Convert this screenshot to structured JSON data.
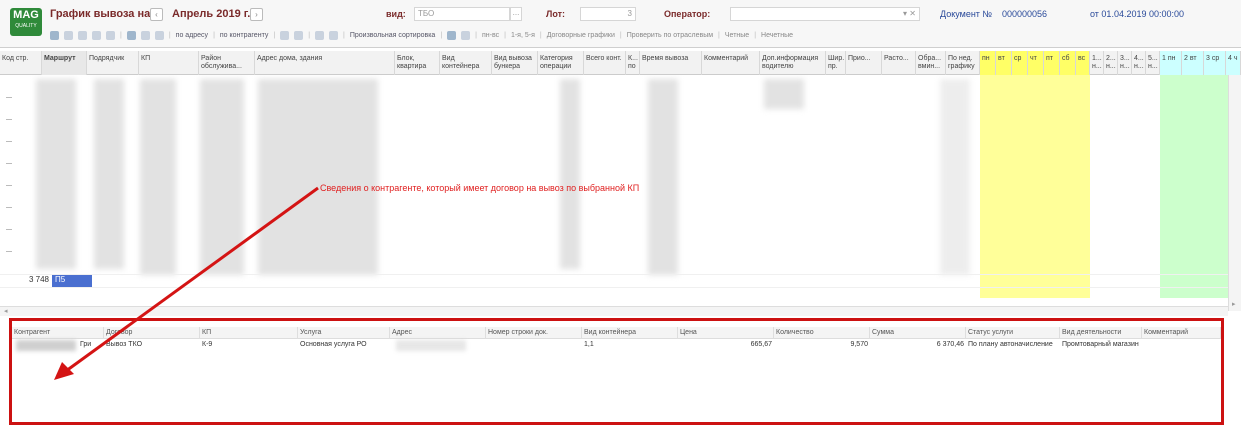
{
  "header": {
    "logo_text": "MAG",
    "logo_sub": "QUALITY",
    "title": "График вывоза на",
    "period": "Апрель 2019 г.",
    "prev_icon": "chevron-left-icon",
    "next_icon": "chevron-right-icon",
    "vid_label": "вид:",
    "vid_value": "ТБО",
    "vid_btn": "...",
    "lot_label": "Лот:",
    "lot_value": "3",
    "operator_label": "Оператор:",
    "operator_btns": "▾ ✕",
    "doc_label": "Документ №",
    "doc_number": "000000056",
    "doc_date": "от  01.04.2019 00:00:00"
  },
  "toolbar": {
    "by_address": "по адресу",
    "by_counterparty": "по контрагенту",
    "custom_sort": "Произвольная сортировка",
    "mon_sun": "пн-вс",
    "fifth_week": "1-я, 5-я",
    "contract_schedules": "Договорные графики",
    "check_industries": "Проверить по отраслевым",
    "even": "Четные",
    "odd": "Нечетные"
  },
  "grid": {
    "columns": [
      "Код стр.",
      "Маршрут",
      "Подрядчик",
      "КП",
      "Район обслужива...",
      "Адрес дома, здания",
      "Блок, квартира",
      "Вид контейнера",
      "Вид вывоза бункера",
      "Категория операции",
      "Всего конт.",
      "К... по",
      "Время вывоза",
      "Комментарий",
      "Доп.информация водителю",
      "Шир. пр.",
      "Прио...",
      "Расто...",
      "Обра... вмин...",
      "По нед. графику",
      "пн",
      "вт",
      "ср",
      "чт",
      "пт",
      "сб",
      "вс",
      "1... н...",
      "2... н...",
      "3... н...",
      "4... н...",
      "5... н...",
      "1 пн",
      "2 вт",
      "3 ср",
      "4 ч"
    ],
    "selected_row_code": "3 748",
    "selected_row_route": "П5"
  },
  "annotation": {
    "text": "Сведения о контрагенте, который имеет договор на вывоз по выбранной КП",
    "color": "#e02020"
  },
  "bottom_table": {
    "columns": [
      "Контрагент",
      "Договор",
      "КП",
      "Услуга",
      "Адрес",
      "Номер строки док.",
      "Вид контейнера",
      "Цена",
      "Количество",
      "Сумма",
      "Статус услуги",
      "Вид деятельности",
      "Комментарий"
    ],
    "row": {
      "counterparty": "Гри",
      "contract": "Вывоз ТКО",
      "kp": "К-9",
      "service": "Основная услуга РО",
      "address": "",
      "doc_line": "",
      "container": "1,1",
      "price": "665,67",
      "quantity": "9,570",
      "sum": "6 370,46",
      "status": "По плану автоначисление",
      "activity": "Промтоварный магазин",
      "comment": ""
    },
    "border_color": "#cc1111"
  }
}
